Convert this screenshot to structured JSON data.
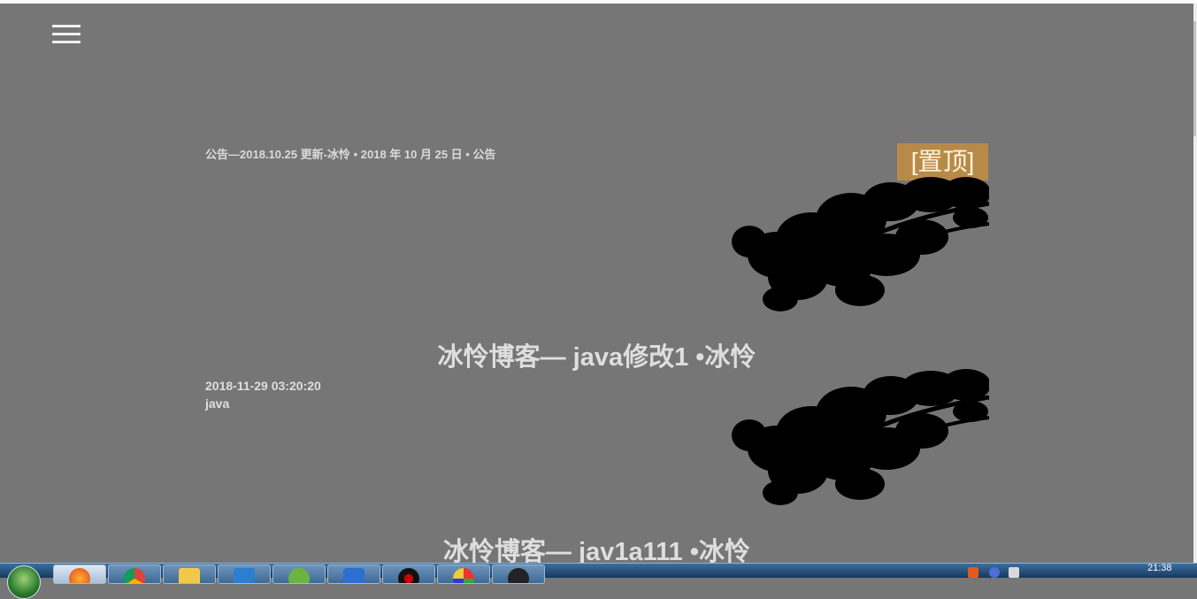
{
  "header": {
    "menu_icon": "hamburger-menu-icon"
  },
  "notice": {
    "text": "公告—2018.10.25 更新-冰怜 • 2018 年 10 月 25 日 • 公告",
    "badge": "[置顶]"
  },
  "posts": [
    {
      "title": "冰怜博客— java修改1 •冰怜",
      "date": "2018-11-29 03:20:20",
      "category": "java"
    },
    {
      "title": "冰怜博客— jav1a111 •冰怜"
    }
  ],
  "taskbar": {
    "apps": [
      "firefox-icon",
      "chrome-icon",
      "file-explorer-icon",
      "vscode-icon",
      "spring-icon",
      "app-icon",
      "recorder-icon",
      "office-icon",
      "avatar-icon"
    ],
    "clock": "21:38"
  },
  "colors": {
    "page_bg": "#767676",
    "badge_bg": "#b88a4a",
    "text": "#dedede"
  }
}
